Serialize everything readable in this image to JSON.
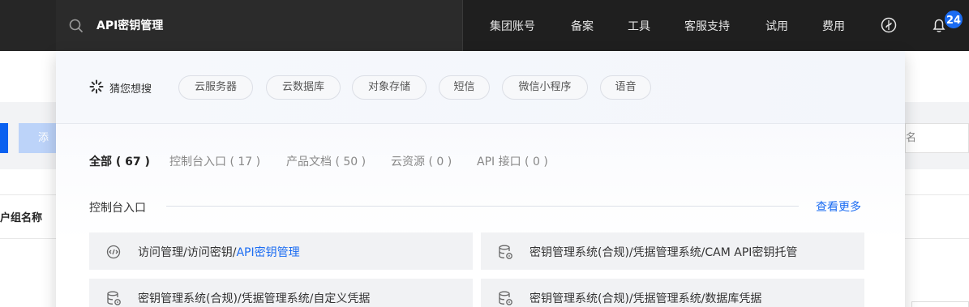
{
  "search": {
    "query": "API密钥管理"
  },
  "nav": {
    "items": [
      "集团账号",
      "备案",
      "工具",
      "客服支持",
      "试用",
      "费用"
    ],
    "notification_count": "24"
  },
  "background": {
    "add_button_label": "添加",
    "right_input_text": "名",
    "column_title": "户组名称"
  },
  "guess": {
    "label": "猜您想搜",
    "chips": [
      "云服务器",
      "云数据库",
      "对象存储",
      "短信",
      "微信小程序",
      "语音"
    ]
  },
  "tabs": [
    {
      "label": "全部 ( 67 )",
      "active": true
    },
    {
      "label": "控制台入口 ( 17 )",
      "active": false
    },
    {
      "label": "产品文档 ( 50 )",
      "active": false
    },
    {
      "label": "云资源 ( 0 )",
      "active": false
    },
    {
      "label": "API 接口 ( 0 )",
      "active": false
    }
  ],
  "section": {
    "title": "控制台入口",
    "more_label": "查看更多"
  },
  "results": [
    {
      "prefix": "访问管理/访问密钥/",
      "highlight": "API密钥管理",
      "icon": "api-icon"
    },
    {
      "prefix": "密钥管理系统(合规)/凭据管理系统/CAM API密钥托管",
      "highlight": "",
      "icon": "database-lock-icon"
    },
    {
      "prefix": "密钥管理系统(合规)/凭据管理系统/自定义凭据",
      "highlight": "",
      "icon": "database-lock-icon"
    },
    {
      "prefix": "密钥管理系统(合规)/凭据管理系统/数据库凭据",
      "highlight": "",
      "icon": "database-lock-icon"
    }
  ],
  "colors": {
    "accent": "#1b6cf2",
    "topbar": "#1f1f1f",
    "badge": "#1b6cf2"
  }
}
